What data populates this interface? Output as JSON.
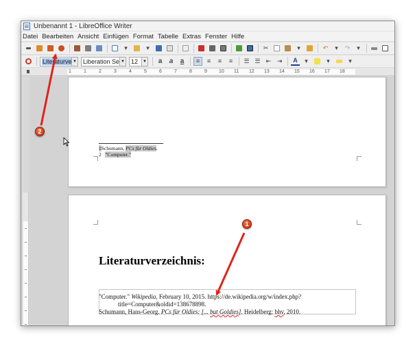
{
  "window": {
    "title": "Unbenannt 1 - LibreOffice Writer"
  },
  "menu": [
    "Datei",
    "Bearbeiten",
    "Ansicht",
    "Einfügen",
    "Format",
    "Tabelle",
    "Extras",
    "Fenster",
    "Hilfe"
  ],
  "formatting": {
    "paragraph_style": "Literaturverze",
    "font_name": "Liberation Serif",
    "font_size": "12"
  },
  "ruler": {
    "numbers": [
      "1",
      "1",
      "2",
      "3",
      "4",
      "5",
      "6",
      "7",
      "8",
      "9",
      "10",
      "11",
      "12",
      "13",
      "14",
      "15",
      "16",
      "17",
      "18"
    ]
  },
  "page1": {
    "footnotes": [
      {
        "num": "1",
        "author": "Schumann, ",
        "title": "PCs für Oldies",
        "after": "."
      },
      {
        "num": "2",
        "text": "\"Computer.\""
      }
    ]
  },
  "page2": {
    "heading": "Literaturverzeichnis:",
    "entry1": {
      "part1": "\"Computer.\" ",
      "source": "Wikipedia",
      "part2": ", February 10, 2015. https://de.wikipedia.org/w/index.php?",
      "line2": "title=Computer&oldid=138678898."
    },
    "entry2": {
      "part1": "Schumann, Hans-Georg. ",
      "title_a": "PCs für Oldies: [... ",
      "title_b": "but Goldies",
      "title_c": "]",
      "part2": ". Heidelberg: ",
      "publisher": "bhv",
      "part3": ", 2010."
    }
  },
  "annotations": {
    "badge1": "1",
    "badge2": "2",
    "arrow_color": "#e0231b"
  }
}
